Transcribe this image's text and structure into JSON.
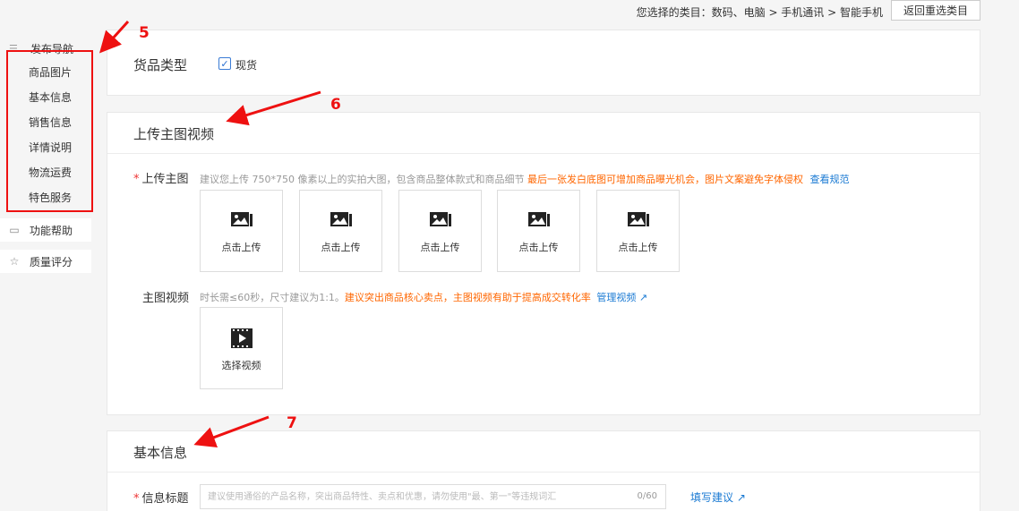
{
  "header": {
    "category_label": "您选择的类目：",
    "category_path": "数码、电脑 > 手机通讯 > 智能手机",
    "reselect_button": "返回重选类目"
  },
  "sidebar": {
    "nav_title": "发布导航",
    "items": [
      "商品图片",
      "基本信息",
      "销售信息",
      "详情说明",
      "物流运费",
      "特色服务"
    ],
    "help": "功能帮助",
    "quality": "质量评分"
  },
  "annotations": [
    "5",
    "6",
    "7"
  ],
  "goods_type": {
    "label": "货品类型",
    "option": "现货",
    "checked": true
  },
  "main_image_section": {
    "title": "上传主图视频",
    "main_image": {
      "label": "上传主图",
      "hint_gray": "建议您上传 750*750 像素以上的实拍大图，包含商品整体款式和商品细节",
      "hint_orange": "最后一张发白底图可增加商品曝光机会，图片文案避免字体侵权",
      "hint_link": "查看规范",
      "slots": [
        "点击上传",
        "点击上传",
        "点击上传",
        "点击上传",
        "点击上传"
      ]
    },
    "main_video": {
      "label": "主图视频",
      "hint_gray": "时长需≤60秒，尺寸建议为1:1。",
      "hint_orange": "建议突出商品核心卖点，主图视频有助于提高成交转化率",
      "hint_link": "管理视频",
      "select_label": "选择视频"
    }
  },
  "basic_info_section": {
    "title": "基本信息",
    "title_field": {
      "label": "信息标题",
      "placeholder": "建议使用通俗的产品名称，突出商品特性、卖点和优惠，请勿使用\"最、第一\"等违规词汇",
      "counter": "0/60",
      "suggest_link": "填写建议"
    }
  },
  "colors": {
    "accent_blue": "#1a7ad3",
    "hint_orange": "#ff6600",
    "annotation_red": "#ee1111"
  }
}
